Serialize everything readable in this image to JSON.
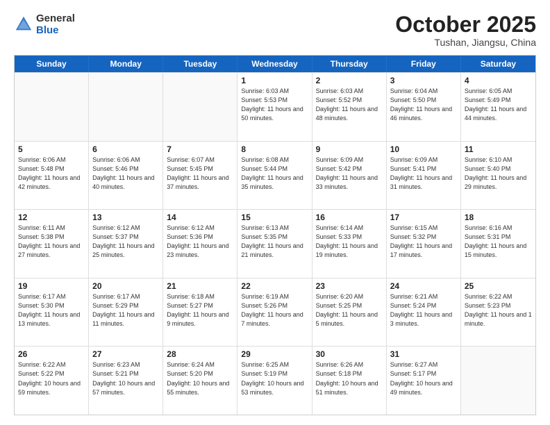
{
  "header": {
    "logo_general": "General",
    "logo_blue": "Blue",
    "month_title": "October 2025",
    "location": "Tushan, Jiangsu, China"
  },
  "weekdays": [
    "Sunday",
    "Monday",
    "Tuesday",
    "Wednesday",
    "Thursday",
    "Friday",
    "Saturday"
  ],
  "rows": [
    [
      {
        "day": "",
        "detail": ""
      },
      {
        "day": "",
        "detail": ""
      },
      {
        "day": "",
        "detail": ""
      },
      {
        "day": "1",
        "detail": "Sunrise: 6:03 AM\nSunset: 5:53 PM\nDaylight: 11 hours\nand 50 minutes."
      },
      {
        "day": "2",
        "detail": "Sunrise: 6:03 AM\nSunset: 5:52 PM\nDaylight: 11 hours\nand 48 minutes."
      },
      {
        "day": "3",
        "detail": "Sunrise: 6:04 AM\nSunset: 5:50 PM\nDaylight: 11 hours\nand 46 minutes."
      },
      {
        "day": "4",
        "detail": "Sunrise: 6:05 AM\nSunset: 5:49 PM\nDaylight: 11 hours\nand 44 minutes."
      }
    ],
    [
      {
        "day": "5",
        "detail": "Sunrise: 6:06 AM\nSunset: 5:48 PM\nDaylight: 11 hours\nand 42 minutes."
      },
      {
        "day": "6",
        "detail": "Sunrise: 6:06 AM\nSunset: 5:46 PM\nDaylight: 11 hours\nand 40 minutes."
      },
      {
        "day": "7",
        "detail": "Sunrise: 6:07 AM\nSunset: 5:45 PM\nDaylight: 11 hours\nand 37 minutes."
      },
      {
        "day": "8",
        "detail": "Sunrise: 6:08 AM\nSunset: 5:44 PM\nDaylight: 11 hours\nand 35 minutes."
      },
      {
        "day": "9",
        "detail": "Sunrise: 6:09 AM\nSunset: 5:42 PM\nDaylight: 11 hours\nand 33 minutes."
      },
      {
        "day": "10",
        "detail": "Sunrise: 6:09 AM\nSunset: 5:41 PM\nDaylight: 11 hours\nand 31 minutes."
      },
      {
        "day": "11",
        "detail": "Sunrise: 6:10 AM\nSunset: 5:40 PM\nDaylight: 11 hours\nand 29 minutes."
      }
    ],
    [
      {
        "day": "12",
        "detail": "Sunrise: 6:11 AM\nSunset: 5:38 PM\nDaylight: 11 hours\nand 27 minutes."
      },
      {
        "day": "13",
        "detail": "Sunrise: 6:12 AM\nSunset: 5:37 PM\nDaylight: 11 hours\nand 25 minutes."
      },
      {
        "day": "14",
        "detail": "Sunrise: 6:12 AM\nSunset: 5:36 PM\nDaylight: 11 hours\nand 23 minutes."
      },
      {
        "day": "15",
        "detail": "Sunrise: 6:13 AM\nSunset: 5:35 PM\nDaylight: 11 hours\nand 21 minutes."
      },
      {
        "day": "16",
        "detail": "Sunrise: 6:14 AM\nSunset: 5:33 PM\nDaylight: 11 hours\nand 19 minutes."
      },
      {
        "day": "17",
        "detail": "Sunrise: 6:15 AM\nSunset: 5:32 PM\nDaylight: 11 hours\nand 17 minutes."
      },
      {
        "day": "18",
        "detail": "Sunrise: 6:16 AM\nSunset: 5:31 PM\nDaylight: 11 hours\nand 15 minutes."
      }
    ],
    [
      {
        "day": "19",
        "detail": "Sunrise: 6:17 AM\nSunset: 5:30 PM\nDaylight: 11 hours\nand 13 minutes."
      },
      {
        "day": "20",
        "detail": "Sunrise: 6:17 AM\nSunset: 5:29 PM\nDaylight: 11 hours\nand 11 minutes."
      },
      {
        "day": "21",
        "detail": "Sunrise: 6:18 AM\nSunset: 5:27 PM\nDaylight: 11 hours\nand 9 minutes."
      },
      {
        "day": "22",
        "detail": "Sunrise: 6:19 AM\nSunset: 5:26 PM\nDaylight: 11 hours\nand 7 minutes."
      },
      {
        "day": "23",
        "detail": "Sunrise: 6:20 AM\nSunset: 5:25 PM\nDaylight: 11 hours\nand 5 minutes."
      },
      {
        "day": "24",
        "detail": "Sunrise: 6:21 AM\nSunset: 5:24 PM\nDaylight: 11 hours\nand 3 minutes."
      },
      {
        "day": "25",
        "detail": "Sunrise: 6:22 AM\nSunset: 5:23 PM\nDaylight: 11 hours\nand 1 minute."
      }
    ],
    [
      {
        "day": "26",
        "detail": "Sunrise: 6:22 AM\nSunset: 5:22 PM\nDaylight: 10 hours\nand 59 minutes."
      },
      {
        "day": "27",
        "detail": "Sunrise: 6:23 AM\nSunset: 5:21 PM\nDaylight: 10 hours\nand 57 minutes."
      },
      {
        "day": "28",
        "detail": "Sunrise: 6:24 AM\nSunset: 5:20 PM\nDaylight: 10 hours\nand 55 minutes."
      },
      {
        "day": "29",
        "detail": "Sunrise: 6:25 AM\nSunset: 5:19 PM\nDaylight: 10 hours\nand 53 minutes."
      },
      {
        "day": "30",
        "detail": "Sunrise: 6:26 AM\nSunset: 5:18 PM\nDaylight: 10 hours\nand 51 minutes."
      },
      {
        "day": "31",
        "detail": "Sunrise: 6:27 AM\nSunset: 5:17 PM\nDaylight: 10 hours\nand 49 minutes."
      },
      {
        "day": "",
        "detail": ""
      }
    ]
  ]
}
